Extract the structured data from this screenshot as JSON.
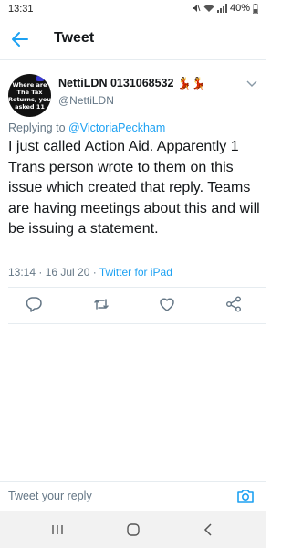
{
  "status_bar": {
    "time": "13:31",
    "battery": "40%",
    "icons": [
      "mute-icon",
      "wifi-icon",
      "signal-icon",
      "battery-icon"
    ]
  },
  "top_bar": {
    "back_icon": "arrow-left-icon",
    "title": "Tweet"
  },
  "tweet": {
    "avatar_text": "Where are The Tax Returns, you asked 11",
    "author_name": "NettiLDN 0131068532",
    "author_emoji": "💃💃",
    "author_handle": "@NettiLDN",
    "replying_prefix": "Replying to ",
    "replying_to": "@VictoriaPeckham",
    "text": "I just called Action Aid. Apparently 1 Trans person wrote to them on this issue which created that reply. Teams are having meetings about this and will be issuing a statement.",
    "timestamp": "13:14 · 16 Jul 20 · ",
    "source": "Twitter for iPad"
  },
  "actions": [
    "reply-icon",
    "retweet-icon",
    "like-icon",
    "share-icon"
  ],
  "reply_bar": {
    "placeholder": "Tweet your reply",
    "camera_icon": "camera-icon"
  },
  "colors": {
    "accent": "#1da1f2",
    "secondary_text": "#657786",
    "primary_text": "#14171a",
    "divider": "#e6ecf0"
  }
}
